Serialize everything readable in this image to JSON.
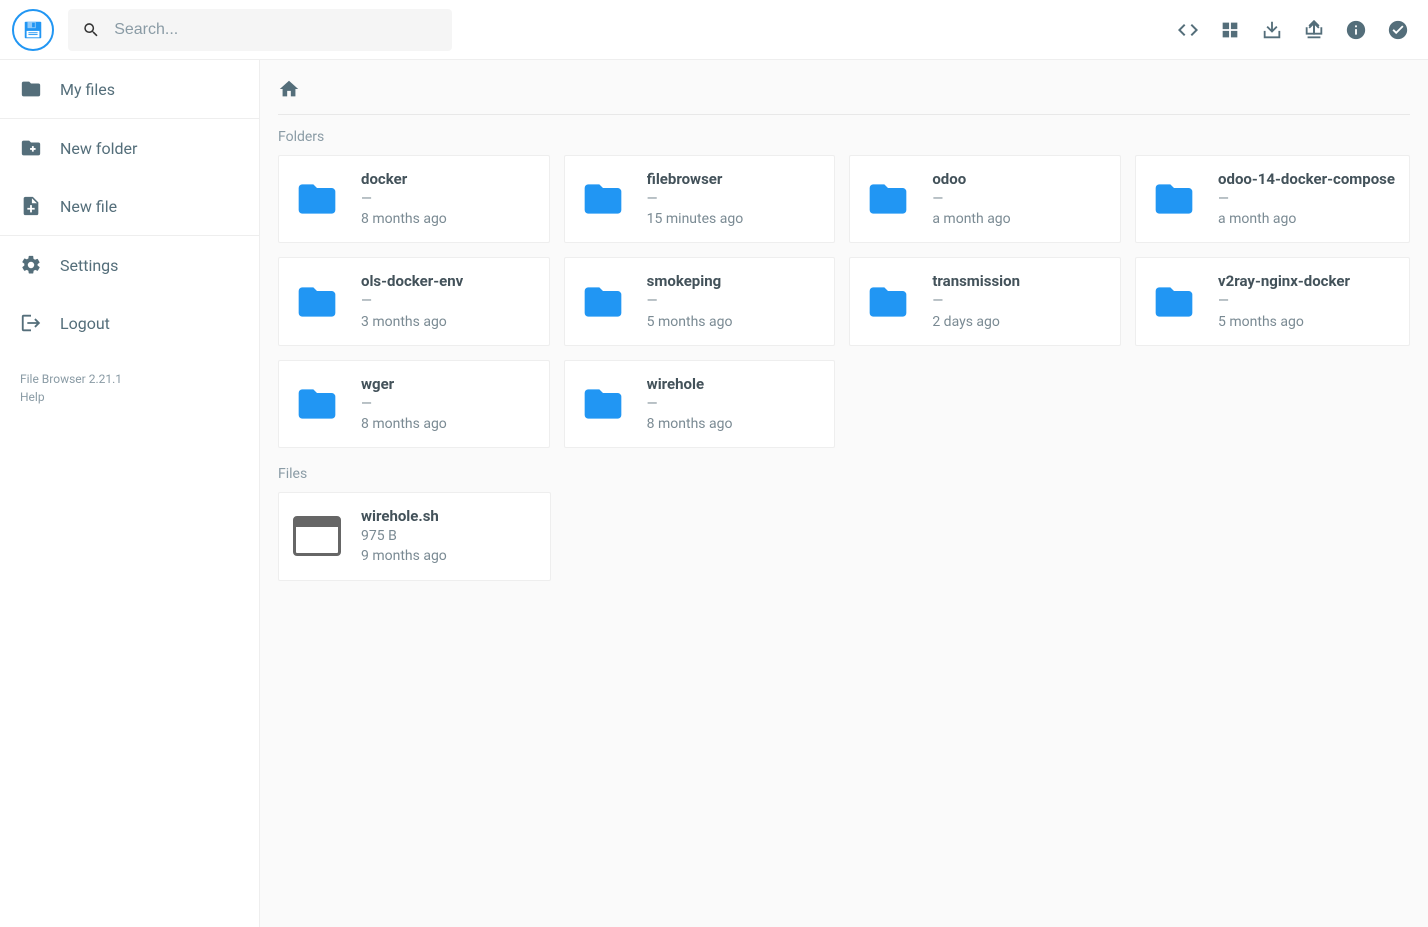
{
  "search": {
    "placeholder": "Search..."
  },
  "sidebar": {
    "items": [
      {
        "label": "My files",
        "icon": "folder"
      },
      {
        "label": "New folder",
        "icon": "create-folder"
      },
      {
        "label": "New file",
        "icon": "note-add"
      },
      {
        "label": "Settings",
        "icon": "settings"
      },
      {
        "label": "Logout",
        "icon": "logout"
      }
    ],
    "version": "File Browser 2.21.1",
    "help": "Help"
  },
  "sections": {
    "folders_label": "Folders",
    "files_label": "Files"
  },
  "folders": [
    {
      "name": "docker",
      "size": "—",
      "time": "8 months ago"
    },
    {
      "name": "filebrowser",
      "size": "—",
      "time": "15 minutes ago"
    },
    {
      "name": "odoo",
      "size": "—",
      "time": "a month ago"
    },
    {
      "name": "odoo-14-docker-compose",
      "size": "—",
      "time": "a month ago"
    },
    {
      "name": "ols-docker-env",
      "size": "—",
      "time": "3 months ago"
    },
    {
      "name": "smokeping",
      "size": "—",
      "time": "5 months ago"
    },
    {
      "name": "transmission",
      "size": "—",
      "time": "2 days ago"
    },
    {
      "name": "v2ray-nginx-docker",
      "size": "—",
      "time": "5 months ago"
    },
    {
      "name": "wger",
      "size": "—",
      "time": "8 months ago"
    },
    {
      "name": "wirehole",
      "size": "—",
      "time": "8 months ago"
    }
  ],
  "files": [
    {
      "name": "wirehole.sh",
      "size": "975 B",
      "time": "9 months ago"
    }
  ]
}
